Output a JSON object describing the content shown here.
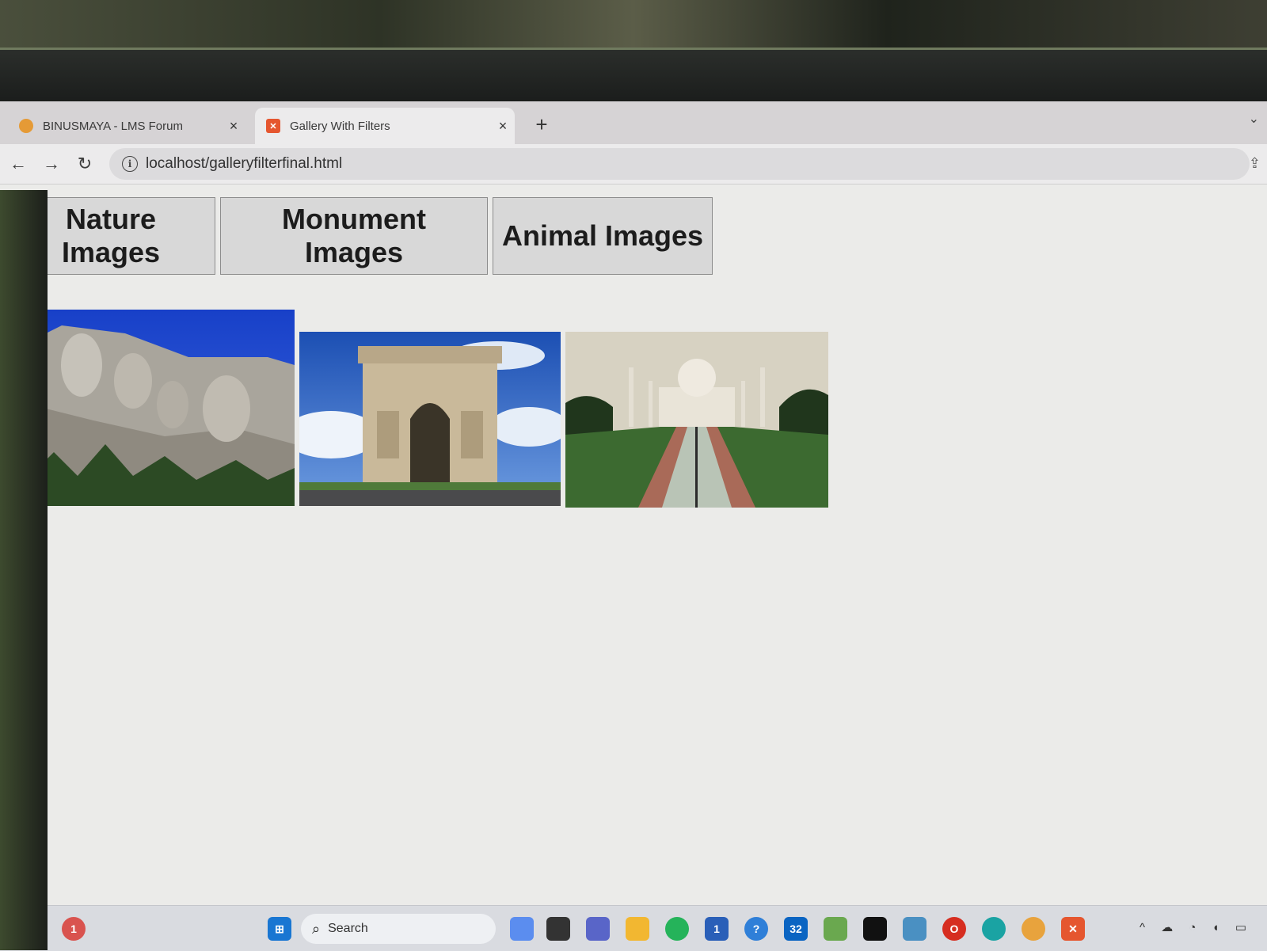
{
  "browser": {
    "tabs": [
      {
        "title": "BINUSMAYA - LMS Forum",
        "icon": "binus-favicon",
        "active": false
      },
      {
        "title": "Gallery With Filters",
        "icon": "xampp-favicon",
        "active": true
      }
    ],
    "close_glyph": "×",
    "new_tab_glyph": "+",
    "url": "localhost/galleryfilterfinal.html"
  },
  "page": {
    "filters": [
      "Nature Images",
      "Monument Images",
      "Animal Images"
    ],
    "gallery": [
      {
        "subject": "mount-rushmore"
      },
      {
        "subject": "arc-de-triomphe"
      },
      {
        "subject": "taj-mahal"
      }
    ]
  },
  "taskbar": {
    "search_label": "Search",
    "badges": {
      "notifications": "1",
      "store": "1",
      "outlook": "32"
    }
  },
  "colors": {
    "tab_strip": "#d6d3d5",
    "page_bg": "#ebebe9",
    "button_bg": "#d8d8d8",
    "xampp_orange": "#e5562f"
  }
}
